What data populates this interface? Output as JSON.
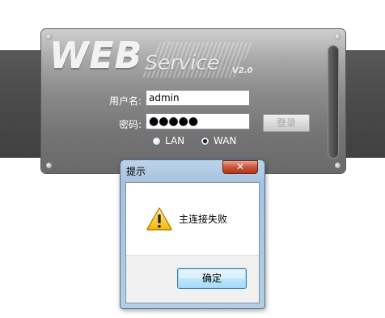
{
  "brand": {
    "logo_web": "WEB",
    "logo_service": "Service",
    "logo_version": "V2.0"
  },
  "login": {
    "username_label": "用户名:",
    "username_value": "admin",
    "password_label": "密码:",
    "password_value": "●●●●●",
    "login_button": "登录",
    "mode_options": [
      {
        "label": "LAN",
        "selected": false
      },
      {
        "label": "WAN",
        "selected": true
      }
    ]
  },
  "dialog": {
    "title": "提示",
    "close_glyph": "✕",
    "message": "主连接失败",
    "ok_button": "确定",
    "icon": "warning-icon"
  },
  "colors": {
    "dialog_frame": "#a6c1de",
    "close_button": "#c9553a",
    "band": "#4a4a4a"
  }
}
